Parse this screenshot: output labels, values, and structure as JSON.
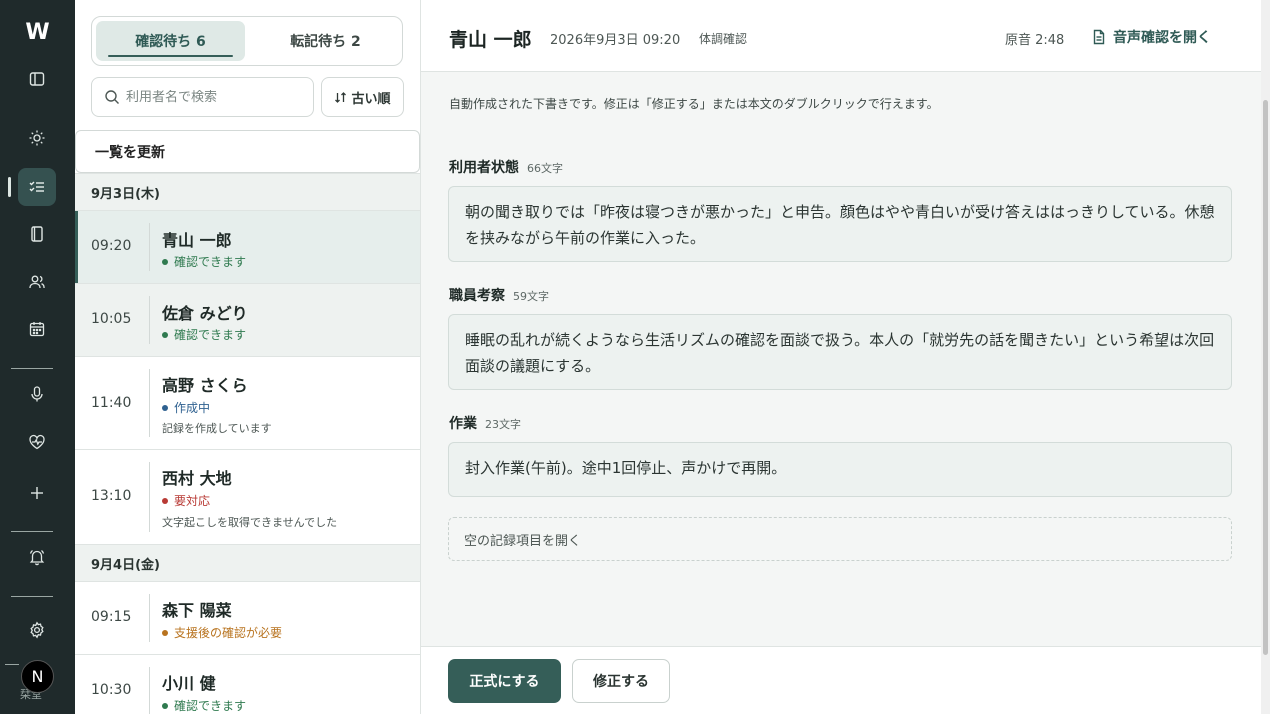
{
  "rail": {
    "logo": "W",
    "avatar_initial": "N",
    "avatar_sub": "栞堂",
    "icons": [
      "sidebar-toggle-icon",
      "sun-icon",
      "checklist-icon",
      "book-icon",
      "users-icon",
      "calendar-icon",
      "microphone-icon",
      "heart-pulse-icon",
      "plus-icon",
      "bell-icon",
      "gear-icon"
    ]
  },
  "list": {
    "tabs": [
      {
        "label": "確認待ち 6",
        "active": true
      },
      {
        "label": "転記待ち 2",
        "active": false
      }
    ],
    "search_placeholder": "利用者名で検索",
    "sort_label": "古い順",
    "refresh_label": "一覧を更新",
    "days": [
      {
        "label": "9月3日(木)"
      },
      {
        "label": "9月4日(金)"
      }
    ],
    "items": [
      {
        "time": "09:20",
        "name": "青山 一郎",
        "status": "確認できます",
        "status_color": "#2f7a4f",
        "note": ""
      },
      {
        "time": "10:05",
        "name": "佐倉 みどり",
        "status": "確認できます",
        "status_color": "#2f7a4f",
        "note": ""
      },
      {
        "time": "11:40",
        "name": "高野 さくら",
        "status": "作成中",
        "status_color": "#2f6190",
        "note": "記録を作成しています"
      },
      {
        "time": "13:10",
        "name": "西村 大地",
        "status": "要対応",
        "status_color": "#b83a35",
        "note": "文字起こしを取得できませんでした"
      },
      {
        "time": "09:15",
        "name": "森下 陽菜",
        "status": "支援後の確認が必要",
        "status_color": "#b8731f",
        "note": ""
      },
      {
        "time": "10:30",
        "name": "小川 健",
        "status": "確認できます",
        "status_color": "#2f7a4f",
        "note": ""
      }
    ]
  },
  "main": {
    "person_name": "青山 一郎",
    "datetime": "2026年9月3日 09:20",
    "tag": "体調確認",
    "orig_audio": "原音 2:48",
    "open_audio_label": "音声確認を開く",
    "notice": "自動作成された下書きです。修正は「修正する」または本文のダブルクリックで行えます。",
    "sections": [
      {
        "title": "利用者状態",
        "count": "66文字",
        "body": "朝の聞き取りでは「昨夜は寝つきが悪かった」と申告。顔色はやや青白いが受け答えははっきりしている。休憩を挟みながら午前の作業に入った。"
      },
      {
        "title": "職員考察",
        "count": "59文字",
        "body": "睡眠の乱れが続くようなら生活リズムの確認を面談で扱う。本人の「就労先の話を聞きたい」という希望は次回面談の議題にする。"
      },
      {
        "title": "作業",
        "count": "23文字",
        "body": "封入作業(午前)。途中1回停止、声かけで再開。"
      }
    ],
    "empty_section_label": "空の記録項目を開く",
    "primary_button": "正式にする",
    "secondary_button": "修正する"
  },
  "colors": {
    "rail_bg": "#1f2a2b",
    "accent": "#355e58",
    "ok": "#2f7a4f",
    "progress": "#2f6190",
    "alert": "#b83a35",
    "warn": "#b8731f"
  }
}
